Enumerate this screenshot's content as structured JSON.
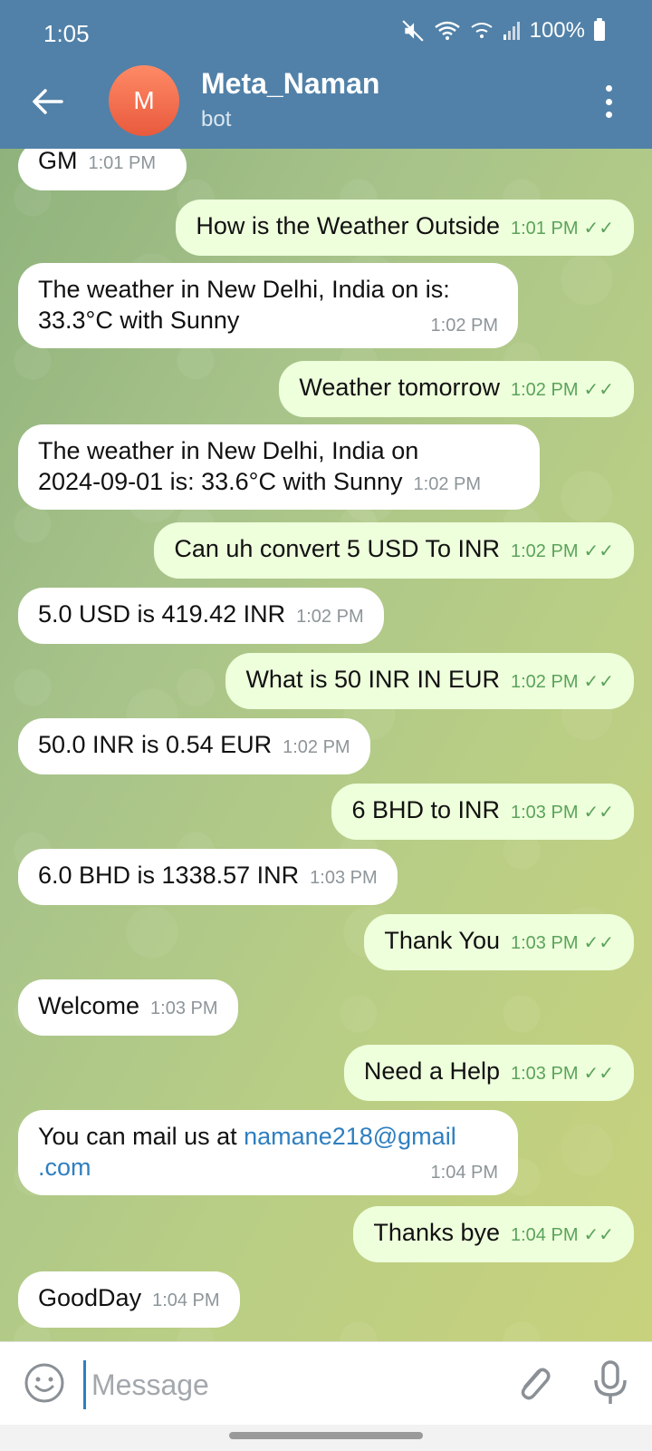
{
  "status": {
    "time": "1:05",
    "battery": "100%"
  },
  "header": {
    "avatar_letter": "M",
    "title": "Meta_Naman",
    "subtitle": "bot"
  },
  "messages": [
    {
      "dir": "in",
      "text": "GM",
      "time": "1:01 PM"
    },
    {
      "dir": "out",
      "text": "How is the Weather Outside",
      "time": "1:01 PM"
    },
    {
      "dir": "in",
      "line1": "The weather in New Delhi, India on  is:",
      "line2": "33.3°C with Sunny",
      "time": "1:02 PM"
    },
    {
      "dir": "out",
      "text": "Weather tomorrow",
      "time": "1:02 PM"
    },
    {
      "dir": "in",
      "line1": "The weather in New Delhi, India on",
      "line2": "2024-09-01 is: 33.6°C with Sunny",
      "time": "1:02 PM"
    },
    {
      "dir": "out",
      "text": "Can uh convert 5 USD To INR",
      "time": "1:02 PM"
    },
    {
      "dir": "in",
      "text": "5.0 USD is 419.42 INR",
      "time": "1:02 PM"
    },
    {
      "dir": "out",
      "text": "What is 50 INR IN EUR",
      "time": "1:02 PM"
    },
    {
      "dir": "in",
      "text": "50.0 INR is 0.54 EUR",
      "time": "1:02 PM"
    },
    {
      "dir": "out",
      "text": "6 BHD to INR",
      "time": "1:03 PM"
    },
    {
      "dir": "in",
      "text": "6.0 BHD is 1338.57 INR",
      "time": "1:03 PM"
    },
    {
      "dir": "out",
      "text": "Thank You",
      "time": "1:03 PM"
    },
    {
      "dir": "in",
      "text": "Welcome",
      "time": "1:03 PM"
    },
    {
      "dir": "out",
      "text": "Need a Help",
      "time": "1:03 PM"
    },
    {
      "dir": "in",
      "prefix": "You can mail us at ",
      "link1": "namane218@gmail",
      "link2": ".com",
      "time": "1:04 PM"
    },
    {
      "dir": "out",
      "text": "Thanks bye",
      "time": "1:04 PM"
    },
    {
      "dir": "in",
      "text": "GoodDay",
      "time": "1:04 PM"
    }
  ],
  "input": {
    "placeholder": "Message"
  },
  "colors": {
    "header": "#5181a8",
    "outgoing_bubble": "#eeffdc",
    "incoming_bubble": "#ffffff",
    "link": "#2f7fc0",
    "tick_green": "#5aa35a"
  }
}
